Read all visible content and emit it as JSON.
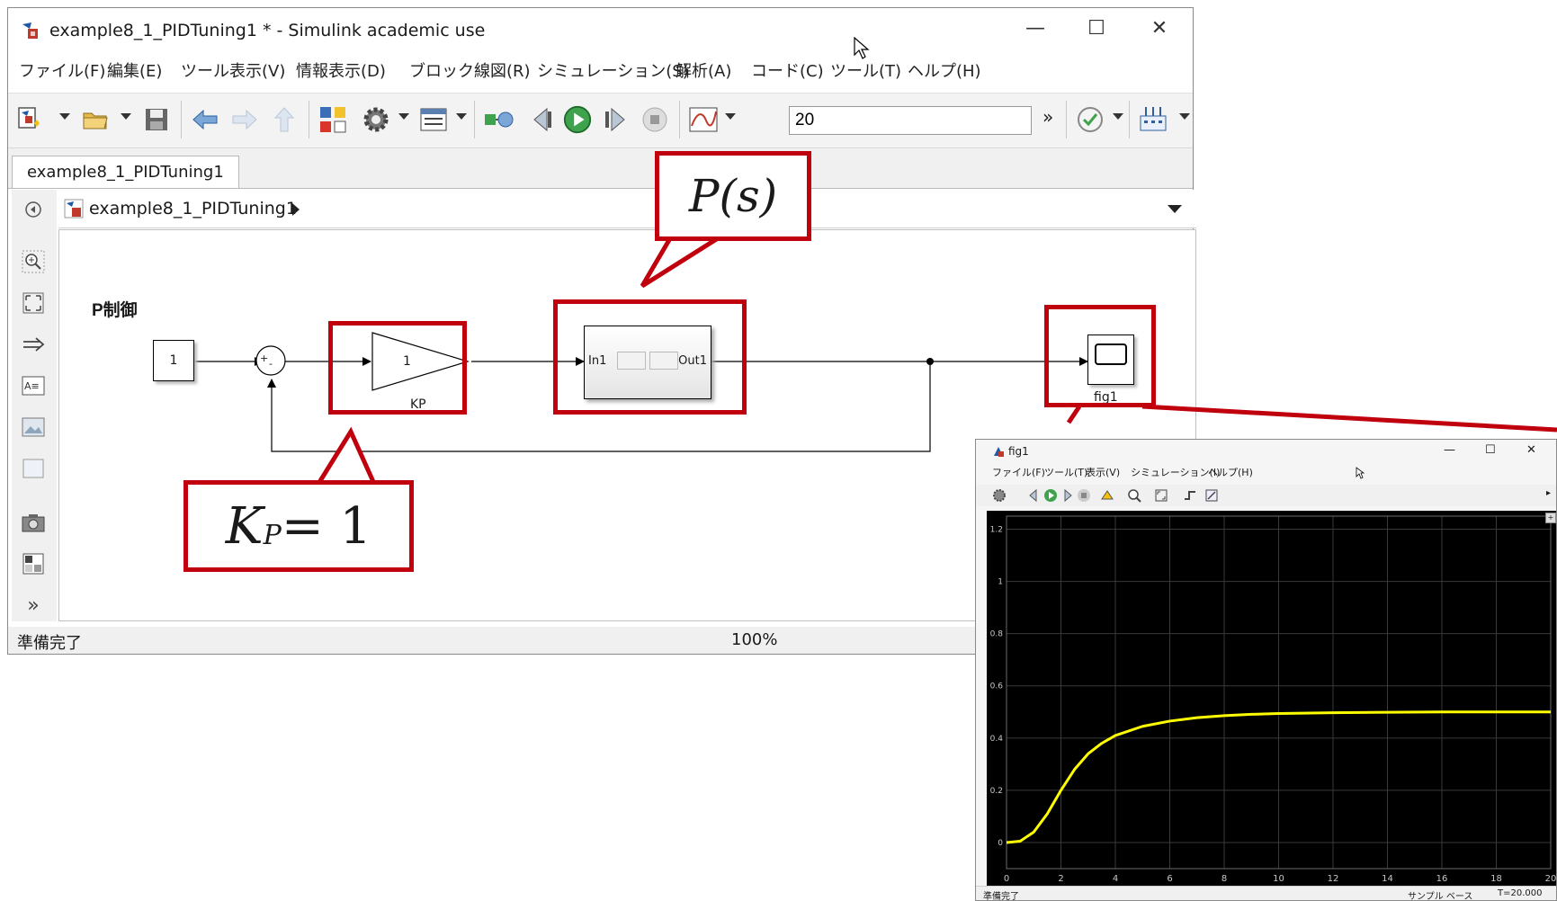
{
  "window": {
    "title": "example8_1_PIDTuning1 * - Simulink academic use",
    "minimize": "—",
    "maximize": "☐",
    "close": "✕"
  },
  "menu": [
    "ファイル(F)",
    "編集(E)",
    "ツール表示(V)",
    "情報表示(D)",
    "ブロック線図(R)",
    "シミュレーション(S)",
    "解析(A)",
    "コード(C)",
    "ツール(T)",
    "ヘルプ(H)"
  ],
  "toolbar": {
    "stop_time": "20",
    "more": "»",
    "icons": [
      "new-model-icon",
      "open-icon",
      "save-icon",
      "back-icon",
      "forward-icon",
      "up-icon",
      "library-browser-icon",
      "settings-gear-icon",
      "model-explorer-icon",
      "update-diagram-icon",
      "step-back-icon",
      "run-icon",
      "step-forward-icon",
      "stop-icon",
      "data-inspector-icon",
      "check-icon",
      "build-icon"
    ]
  },
  "tab": {
    "label": "example8_1_PIDTuning1"
  },
  "address": {
    "path": "example8_1_PIDTuning1"
  },
  "diagram": {
    "title": "P制御",
    "constant_value": "1",
    "sum_signs": [
      "+",
      "-"
    ],
    "gain_value": "1",
    "gain_name": "KP",
    "subsystem_in": "In1",
    "subsystem_out": "Out1",
    "scope_name": "fig1"
  },
  "status": {
    "left": "準備完了",
    "zoom": "100%"
  },
  "annotations": {
    "plant": "P(s)",
    "gain": "K",
    "gain_sub": "P",
    "gain_rest": " = 1",
    "color": "#c0000c"
  },
  "scope": {
    "title": "fig1",
    "minimize": "—",
    "maximize": "☐",
    "close": "✕",
    "menu": [
      "ファイル(F)",
      "ツール(T)",
      "表示(V)",
      "シミュレーション(I)",
      "ヘルプ(H)"
    ],
    "status_left": "準備完了",
    "status_mode": "サンプル ベース",
    "status_time": "T=20.000"
  },
  "chart_data": {
    "type": "line",
    "xlim": [
      0,
      20
    ],
    "ylim": [
      -0.1,
      1.25
    ],
    "x_ticks": [
      0,
      2,
      4,
      6,
      8,
      10,
      12,
      14,
      16,
      18,
      20
    ],
    "y_ticks": [
      0,
      0.2,
      0.4,
      0.6,
      0.8,
      1,
      1.2
    ],
    "grid": true,
    "line_color": "#ffff00",
    "background": "#000000",
    "x": [
      0,
      0.5,
      1,
      1.5,
      2,
      2.5,
      3,
      3.5,
      4,
      5,
      6,
      7,
      8,
      9,
      10,
      12,
      14,
      16,
      18,
      20
    ],
    "y": [
      0,
      0.005,
      0.04,
      0.11,
      0.2,
      0.28,
      0.34,
      0.38,
      0.41,
      0.445,
      0.465,
      0.478,
      0.486,
      0.491,
      0.494,
      0.497,
      0.499,
      0.5,
      0.5,
      0.5
    ]
  }
}
